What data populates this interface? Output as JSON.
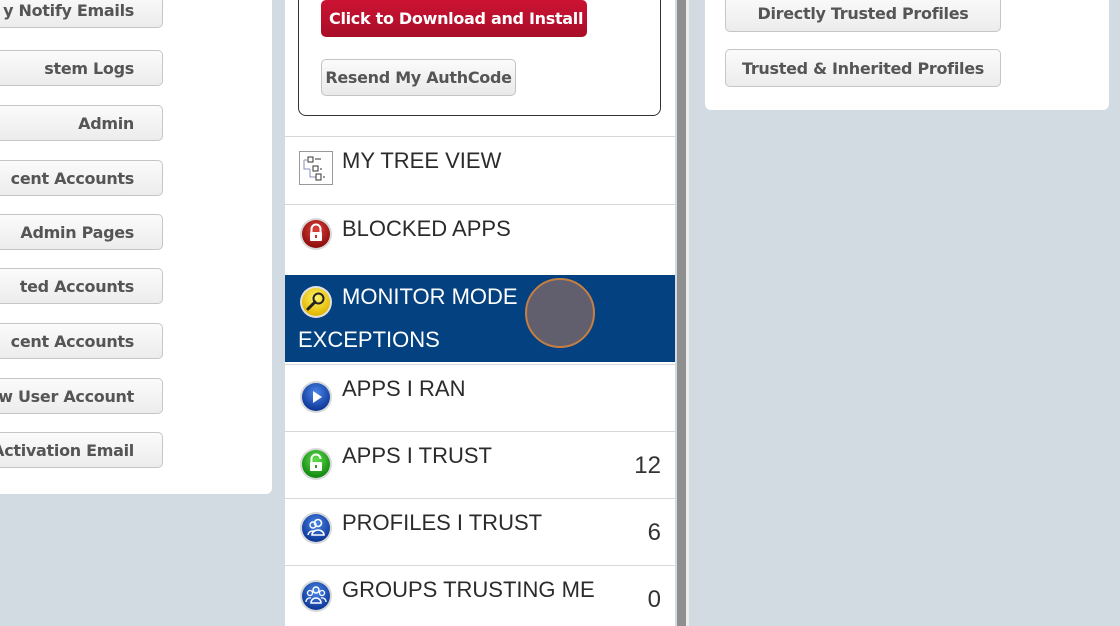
{
  "left_panel": {
    "buttons": [
      {
        "label": "y Notify Emails"
      },
      {
        "label": "stem Logs"
      },
      {
        "label": "Admin"
      },
      {
        "label": "cent Accounts"
      },
      {
        "label": "Admin Pages"
      },
      {
        "label": "ted Accounts"
      },
      {
        "label": "cent Accounts"
      },
      {
        "label": "ew User Account"
      },
      {
        "label": "Activation Email"
      }
    ]
  },
  "install_box": {
    "download_label": "Click to Download and Install",
    "resend_label": "Resend My AuthCode",
    "download_color": "#b70f2c"
  },
  "nav": {
    "items": [
      {
        "label": "MY TREE VIEW",
        "icon": "tree-view-icon",
        "count": null
      },
      {
        "label": "BLOCKED APPS",
        "icon": "red-lock-icon",
        "count": null
      },
      {
        "label": "MONITOR MODE",
        "label_line2": "EXCEPTIONS",
        "icon": "magnifier-icon",
        "count": null,
        "active": true
      },
      {
        "label": "APPS I RAN",
        "icon": "play-icon",
        "count": null
      },
      {
        "label": "APPS I TRUST",
        "icon": "green-unlock-icon",
        "count": "12"
      },
      {
        "label": "PROFILES I TRUST",
        "icon": "profile-users-icon",
        "count": "6"
      },
      {
        "label": "GROUPS TRUSTING ME",
        "icon": "group-users-icon",
        "count": "0"
      }
    ],
    "active_color": "#044181"
  },
  "right_panel": {
    "buttons": [
      {
        "label": "Directly Trusted Profiles"
      },
      {
        "label": "Trusted & Inherited Profiles"
      }
    ]
  }
}
